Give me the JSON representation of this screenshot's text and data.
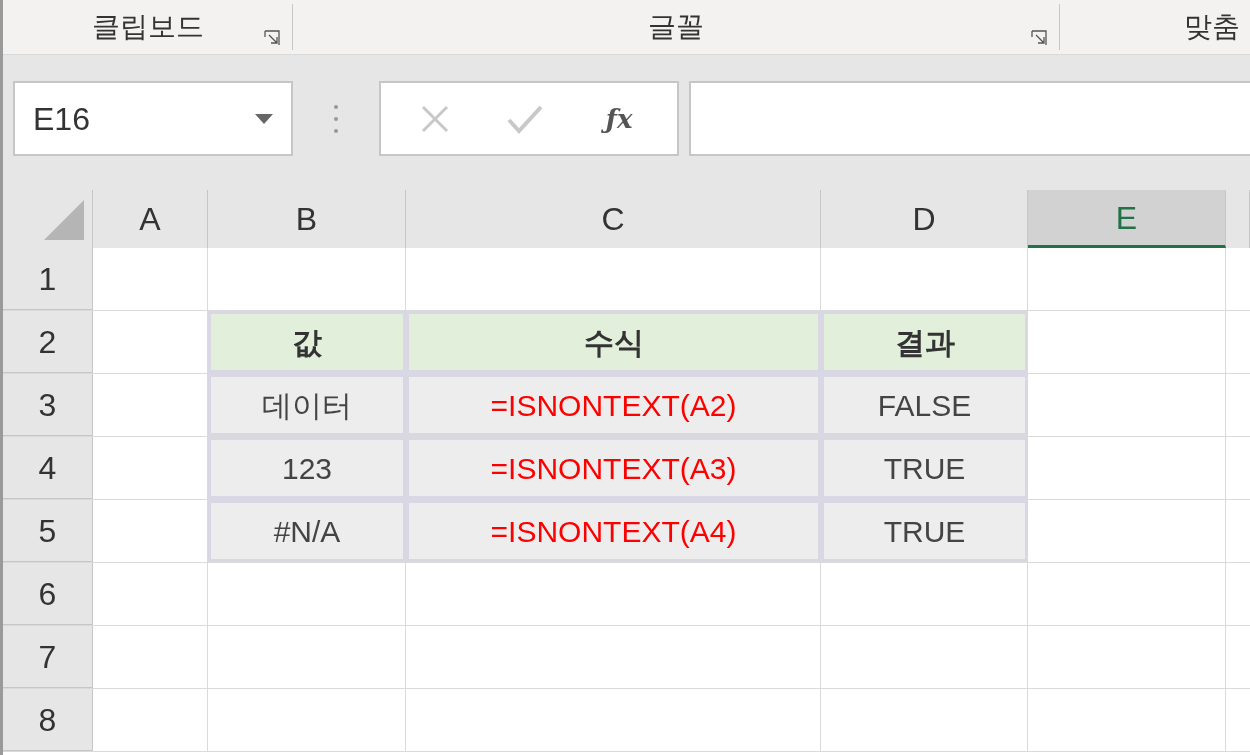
{
  "ribbon": {
    "groups": [
      {
        "label": "클립보드",
        "launcher": true
      },
      {
        "label": "글꼴",
        "launcher": true
      },
      {
        "label": "맞춤",
        "launcher": false
      }
    ]
  },
  "formula_bar": {
    "name_box": "E16",
    "function_symbol": "ƒx"
  },
  "columns": [
    {
      "label": "A",
      "selected": false
    },
    {
      "label": "B",
      "selected": false
    },
    {
      "label": "C",
      "selected": false
    },
    {
      "label": "D",
      "selected": false
    },
    {
      "label": "E",
      "selected": true
    }
  ],
  "rows": [
    {
      "label": "1"
    },
    {
      "label": "2",
      "cells": [
        {
          "kind": "header",
          "text": "값"
        },
        {
          "kind": "header",
          "text": "수식"
        },
        {
          "kind": "header",
          "text": "결과"
        }
      ]
    },
    {
      "label": "3",
      "cells": [
        {
          "kind": "value",
          "text": "데이터"
        },
        {
          "kind": "formula",
          "text": "=ISNONTEXT(A2)"
        },
        {
          "kind": "value",
          "text": "FALSE"
        }
      ]
    },
    {
      "label": "4",
      "cells": [
        {
          "kind": "value",
          "text": "123"
        },
        {
          "kind": "formula",
          "text": "=ISNONTEXT(A3)"
        },
        {
          "kind": "value",
          "text": "TRUE"
        }
      ]
    },
    {
      "label": "5",
      "cells": [
        {
          "kind": "value",
          "text": "#N/A"
        },
        {
          "kind": "formula",
          "text": "=ISNONTEXT(A4)"
        },
        {
          "kind": "value",
          "text": "TRUE"
        }
      ]
    },
    {
      "label": "6"
    },
    {
      "label": "7"
    },
    {
      "label": "8"
    }
  ]
}
